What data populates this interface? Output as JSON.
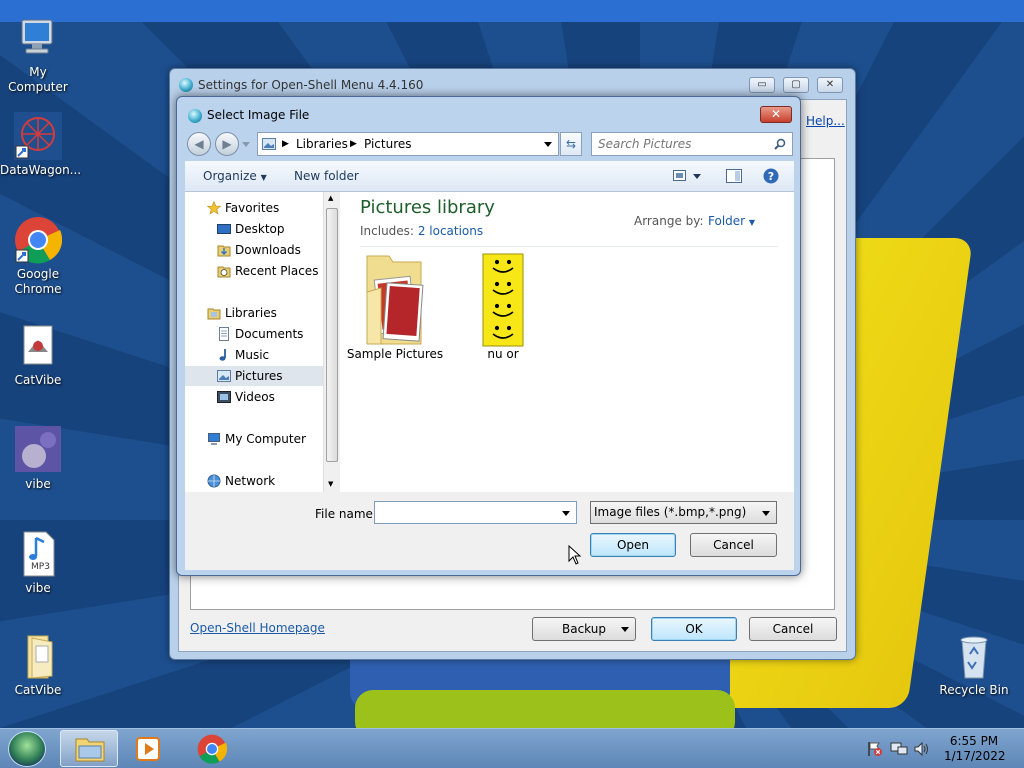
{
  "desktop": {
    "icons": [
      {
        "label": "My Computer",
        "icon": "my-computer-icon"
      },
      {
        "label": "DataWagon...",
        "icon": "datawagon-icon"
      },
      {
        "label": "Google Chrome",
        "icon": "chrome-icon"
      },
      {
        "label": "CatVibe",
        "icon": "catvibe-app-icon"
      },
      {
        "label": "vibe",
        "icon": "vibe-image-icon"
      },
      {
        "label": "vibe",
        "icon": "mp3-file-icon"
      },
      {
        "label": "CatVibe",
        "icon": "folder-icon"
      },
      {
        "label": "Recycle Bin",
        "icon": "recycle-bin-icon"
      }
    ],
    "mp3_badge": "MP3"
  },
  "settings_window": {
    "title": "Settings for Open-Shell Menu 4.4.160",
    "help_link": "Help...",
    "homepage_link": "Open-Shell Homepage",
    "backup_button": "Backup",
    "ok_button": "OK",
    "cancel_button": "Cancel"
  },
  "file_dialog": {
    "title": "Select Image File",
    "close_glyph": "✕",
    "breadcrumb": [
      "Libraries",
      "Pictures"
    ],
    "search_placeholder": "Search Pictures",
    "toolbar": {
      "organize": "Organize",
      "new_folder": "New folder"
    },
    "nav": {
      "favorites": "Favorites",
      "desktop": "Desktop",
      "downloads": "Downloads",
      "recent_places": "Recent Places",
      "libraries": "Libraries",
      "documents": "Documents",
      "music": "Music",
      "pictures": "Pictures",
      "videos": "Videos",
      "my_computer": "My Computer",
      "network": "Network"
    },
    "library": {
      "title": "Pictures library",
      "includes_label": "Includes:",
      "locations": "2 locations",
      "arrange_label": "Arrange by:",
      "arrange_value": "Folder"
    },
    "files": [
      {
        "name": "Sample Pictures",
        "icon": "sample-pictures-folder-icon"
      },
      {
        "name": "nu or",
        "icon": "smiley-image-icon"
      }
    ],
    "filename_label": "File name:",
    "filename_value": "",
    "filetype": "Image files (*.bmp,*.png)",
    "open_button": "Open",
    "cancel_button": "Cancel"
  },
  "taskbar": {
    "time": "6:55 PM",
    "date": "1/17/2022"
  }
}
